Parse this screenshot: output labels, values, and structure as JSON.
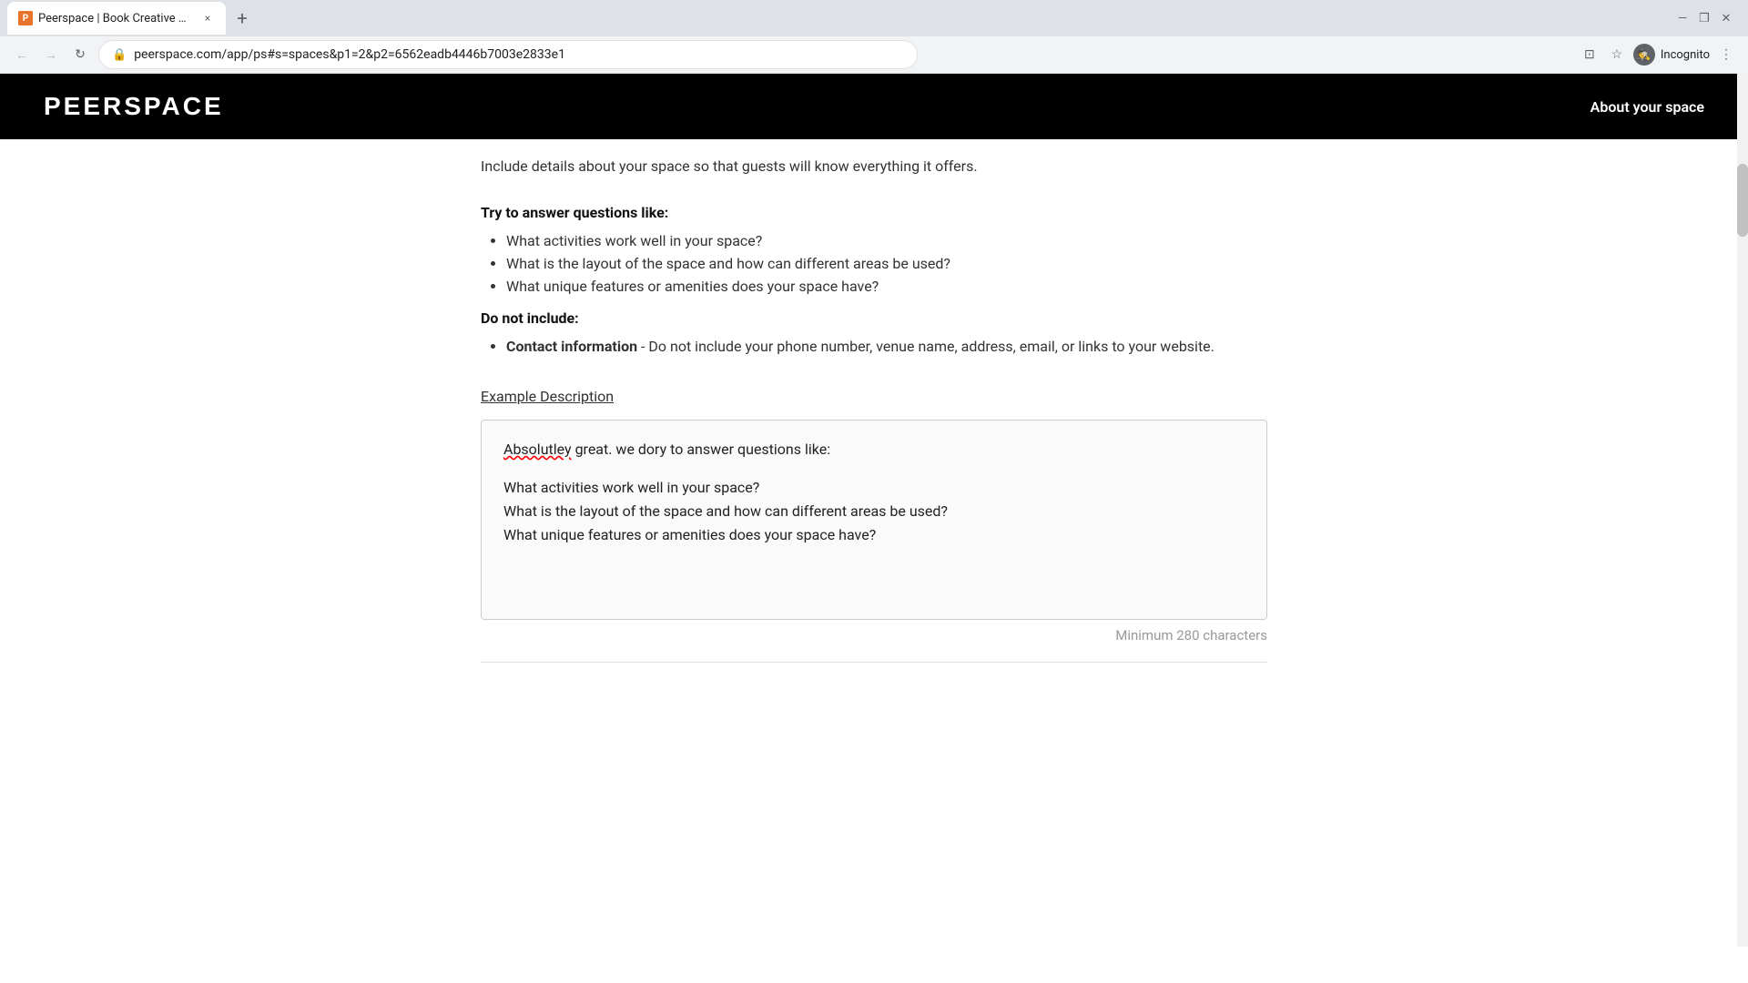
{
  "browser": {
    "tab_favicon": "P",
    "tab_title": "Peerspace | Book Creative Space...",
    "tab_close": "×",
    "new_tab": "+",
    "window_minimize": "—",
    "window_maximize": "❐",
    "window_close": "✕",
    "window_back_arrow": "↕",
    "nav_back": "←",
    "nav_forward": "→",
    "nav_reload": "↻",
    "url_lock": "🔒",
    "url": "peerspace.com/app/ps#s=spaces&p1=2&p2=6562eadb4446b7003e2833e1",
    "icon_cast": "⊡",
    "icon_star": "☆",
    "icon_profile": "⊙",
    "icon_menu": "⋮",
    "incognito_label": "Incognito"
  },
  "header": {
    "logo": "PEERSPACE",
    "nav_link": "About your space"
  },
  "content": {
    "partial_intro": "Include details about your space so that guests will know everything it offers.",
    "try_title": "Try to answer questions like:",
    "try_questions": [
      "What activities work well in your space?",
      "What is the layout of the space and how can different areas be used?",
      "What unique features or amenities does your space have?"
    ],
    "do_not_title": "Do not include:",
    "do_not_items": [
      {
        "bold": "Contact information",
        "rest": " - Do not include your phone number, venue name, address, email, or links to your website."
      }
    ],
    "example_link": "Example Description",
    "description_box": {
      "line1_misspelled": "Absolutley",
      "line1_rest": " great. we dory to answer questions like:",
      "blank_line": "",
      "line2": "What activities work well in your space?",
      "line3": "What is the layout of the space and how can different areas be used?",
      "line4": "What unique features or amenities does your space have?"
    },
    "char_minimum": "Minimum 280 characters"
  }
}
